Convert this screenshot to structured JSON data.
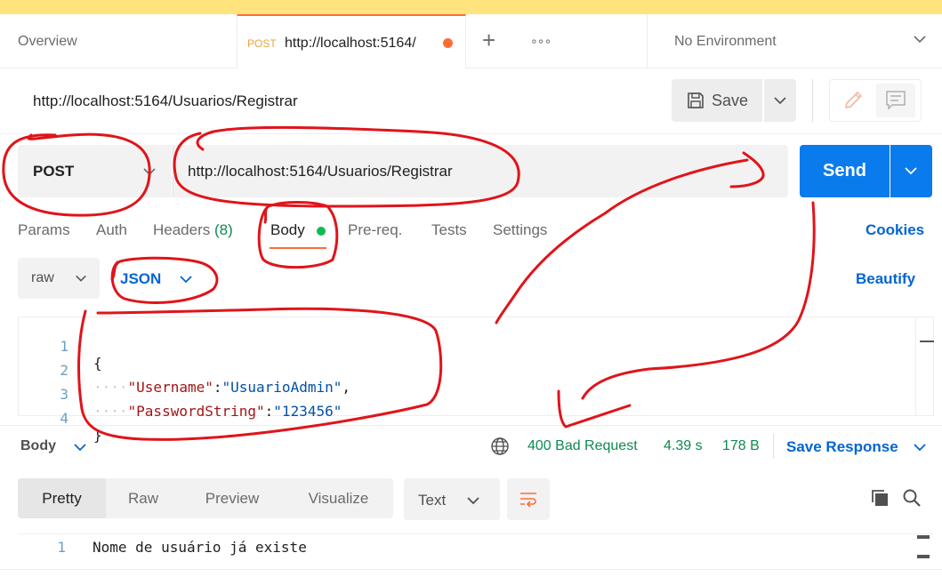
{
  "tabs": {
    "overview_label": "Overview",
    "active_method": "POST",
    "active_url": "http://localhost:5164/",
    "plus": "+",
    "more": "∘∘∘"
  },
  "environment": {
    "label": "No Environment"
  },
  "request": {
    "name": "http://localhost:5164/Usuarios/Registrar",
    "method": "POST",
    "url": "http://localhost:5164/Usuarios/Registrar",
    "save_label": "Save",
    "send_label": "Send"
  },
  "request_tabs": {
    "params": "Params",
    "auth": "Auth",
    "headers": "Headers",
    "headers_count": "(8)",
    "body": "Body",
    "prereq": "Pre-req.",
    "tests": "Tests",
    "settings": "Settings",
    "cookies": "Cookies"
  },
  "body_options": {
    "mode": "raw",
    "language": "JSON",
    "beautify": "Beautify"
  },
  "editor": {
    "lines": [
      {
        "no": "1",
        "brace": "{"
      },
      {
        "no": "2",
        "ws": "····",
        "key": "\"Username\"",
        "sep": ":",
        "val": "\"UsuarioAdmin\"",
        "end": ","
      },
      {
        "no": "3",
        "ws": "····",
        "key": "\"PasswordString\"",
        "sep": ":",
        "val": "\"123456\"",
        "end": ""
      },
      {
        "no": "4",
        "brace": "}"
      }
    ]
  },
  "response": {
    "body_label": "Body",
    "status": "400 Bad Request",
    "time": "4.39 s",
    "size": "178 B",
    "save_response": "Save Response",
    "view_tabs": [
      "Pretty",
      "Raw",
      "Preview",
      "Visualize"
    ],
    "format": "Text",
    "lines": [
      {
        "no": "1",
        "text": "Nome de usuário já existe"
      }
    ]
  },
  "colors": {
    "accent": "#ff6c37",
    "send": "#097bed",
    "link": "#0265d2",
    "success": "#0f8a4f",
    "annotation": "#e0141a"
  }
}
